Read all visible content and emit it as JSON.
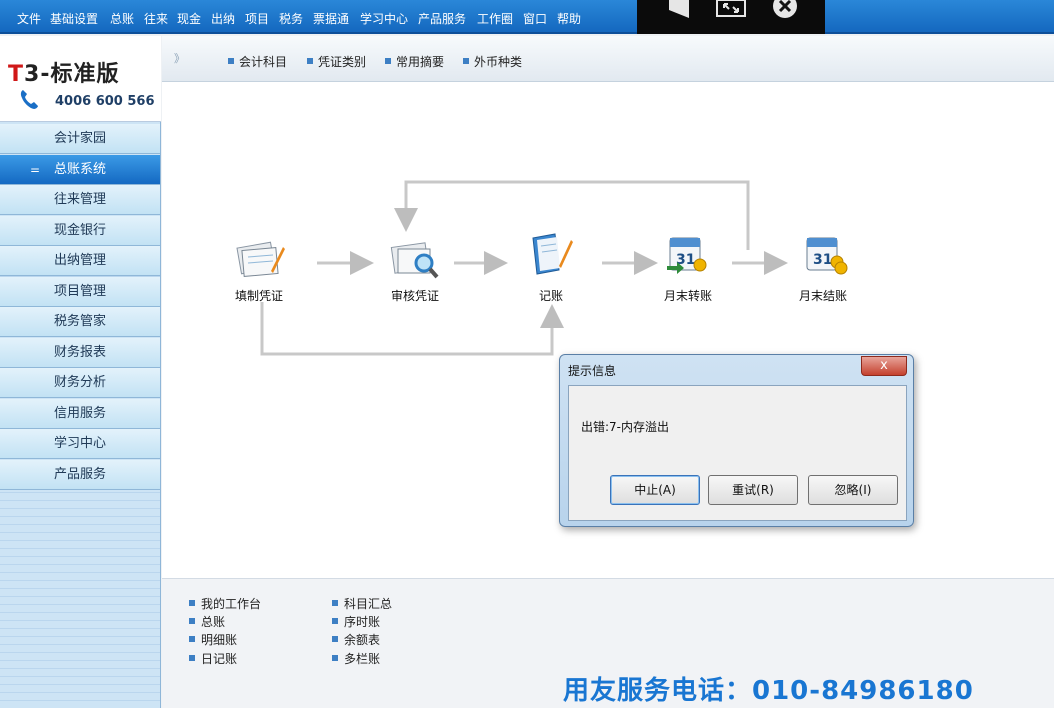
{
  "menu": [
    "文件",
    "基础设置",
    "总账",
    "往来",
    "现金",
    "出纳",
    "项目",
    "税务",
    "票据通",
    "学习中心",
    "产品服务",
    "工作圈",
    "窗口",
    "帮助"
  ],
  "video_controls": [
    "play-icon",
    "fullscreen-icon",
    "close-circle-icon"
  ],
  "logo": {
    "brand_prefix": "T",
    "brand_rest": "3-标准版",
    "phone": "4006 600 566"
  },
  "sidebar": {
    "items": [
      {
        "label": "会计家园",
        "active": false
      },
      {
        "label": "总账系统",
        "active": true
      },
      {
        "label": "往来管理",
        "active": false
      },
      {
        "label": "现金银行",
        "active": false
      },
      {
        "label": "出纳管理",
        "active": false
      },
      {
        "label": "项目管理",
        "active": false
      },
      {
        "label": "税务管家",
        "active": false
      },
      {
        "label": "财务报表",
        "active": false
      },
      {
        "label": "财务分析",
        "active": false
      },
      {
        "label": "信用服务",
        "active": false
      },
      {
        "label": "学习中心",
        "active": false
      },
      {
        "label": "产品服务",
        "active": false
      }
    ],
    "active_marker": "="
  },
  "tabs": {
    "chevron": "》",
    "items": [
      "会计科目",
      "凭证类别",
      "常用摘要",
      "外币种类"
    ]
  },
  "flow": {
    "nodes": [
      {
        "label": "填制凭证",
        "icon": "fill-voucher-icon"
      },
      {
        "label": "审核凭证",
        "icon": "audit-voucher-icon"
      },
      {
        "label": "记账",
        "icon": "bookkeeping-icon"
      },
      {
        "label": "月末转账",
        "icon": "month-end-transfer-icon"
      },
      {
        "label": "月末结账",
        "icon": "month-end-close-icon"
      }
    ]
  },
  "quick_links": {
    "col1": [
      "我的工作台",
      "总账",
      "明细账",
      "日记账"
    ],
    "col2": [
      "科目汇总",
      "序时账",
      "余额表",
      "多栏账"
    ]
  },
  "hotline": "用友服务电话：010-84986180",
  "dialog": {
    "title": "提示信息",
    "close": "x",
    "message": "出错:7-内存溢出",
    "buttons": [
      "中止(A)",
      "重试(R)",
      "忽略(I)"
    ]
  },
  "colors": {
    "menu_bg": "#1468bf",
    "active_nav": "#1469c2",
    "hotline": "#1976d2"
  }
}
